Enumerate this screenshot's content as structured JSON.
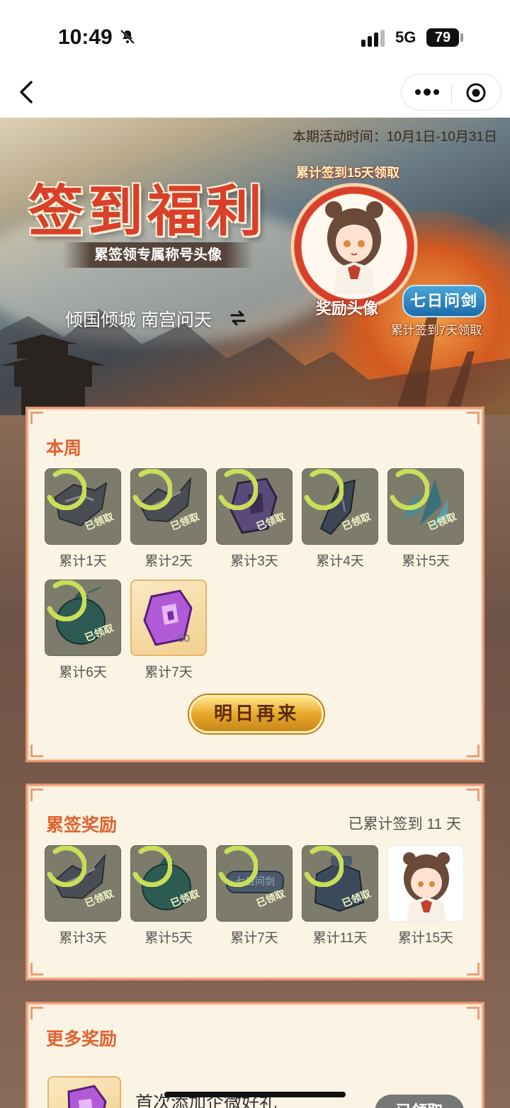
{
  "status_bar": {
    "time": "10:49",
    "network": "5G",
    "battery": "79"
  },
  "hero": {
    "period": "本期活动时间：10月1日-10月31日",
    "title": "签到福利",
    "subtitle": "累签领专属称号头像",
    "names": "倾国倾城 南宫问天",
    "avatar_caption_top": "累计签到15天领取",
    "avatar_caption": "奖励头像",
    "title_badge": "七日问剑",
    "title_badge_caption": "累计签到7天领取"
  },
  "week": {
    "title": "本周",
    "items": [
      {
        "label": "累计1天",
        "status": "已领取"
      },
      {
        "label": "累计2天",
        "status": "已领取"
      },
      {
        "label": "累计3天",
        "status": "已领取"
      },
      {
        "label": "累计4天",
        "status": "已领取"
      },
      {
        "label": "累计5天",
        "status": "已领取"
      },
      {
        "label": "累计6天",
        "status": "已领取"
      },
      {
        "label": "累计7天",
        "count": "50"
      }
    ],
    "button": "明日再来"
  },
  "cumulative": {
    "title": "累签奖励",
    "summary": "已累计签到 11 天",
    "items": [
      {
        "label": "累计3天",
        "status": "已领取"
      },
      {
        "label": "累计5天",
        "status": "已领取"
      },
      {
        "label": "累计7天",
        "status": "已领取",
        "badge_text": "七日问剑"
      },
      {
        "label": "累计11天",
        "status": "已领取"
      },
      {
        "label": "累计15天"
      }
    ]
  },
  "more": {
    "title": "更多奖励",
    "item_name": "首次添加企微好礼",
    "item_button": "已领取"
  }
}
